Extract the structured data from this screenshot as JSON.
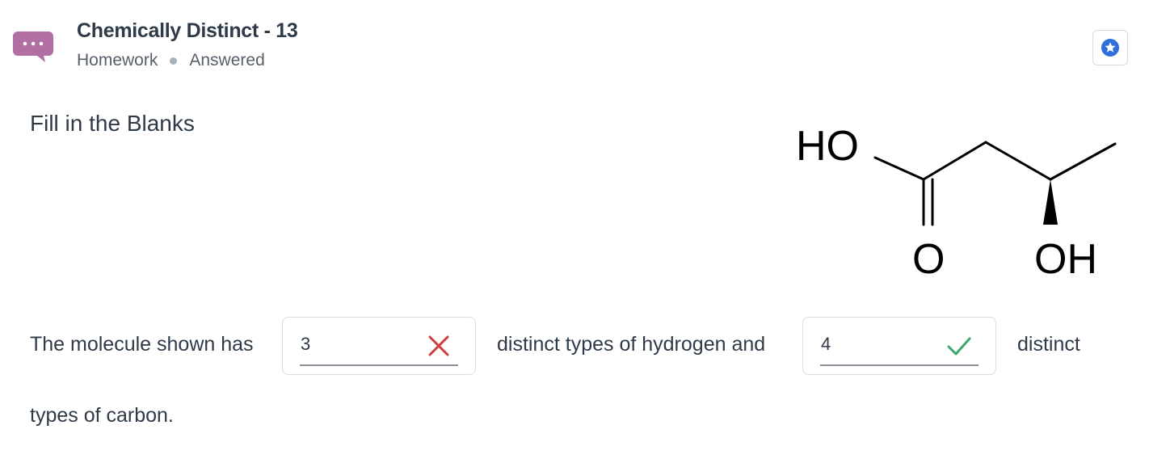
{
  "header": {
    "title": "Chemically Distinct - 13",
    "meta_type": "Homework",
    "meta_status": "Answered",
    "chat_icon": "chat-bubble-icon",
    "star_icon": "star-icon",
    "accent_color": "#b16fa4",
    "star_color": "#2f6fdb"
  },
  "question": {
    "section_title": "Fill in the Blanks",
    "molecule": {
      "labels": [
        "HO",
        "O",
        "OH"
      ]
    },
    "text_part1": "The molecule shown has",
    "text_part2": "distinct types of hydrogen and",
    "text_part3": "distinct",
    "text_part4": "types of carbon.",
    "blanks": [
      {
        "value": "3",
        "status": "incorrect",
        "icon": "x-mark-icon",
        "color": "#d13b3b"
      },
      {
        "value": "4",
        "status": "correct",
        "icon": "check-mark-icon",
        "color": "#3aa76d"
      }
    ]
  }
}
